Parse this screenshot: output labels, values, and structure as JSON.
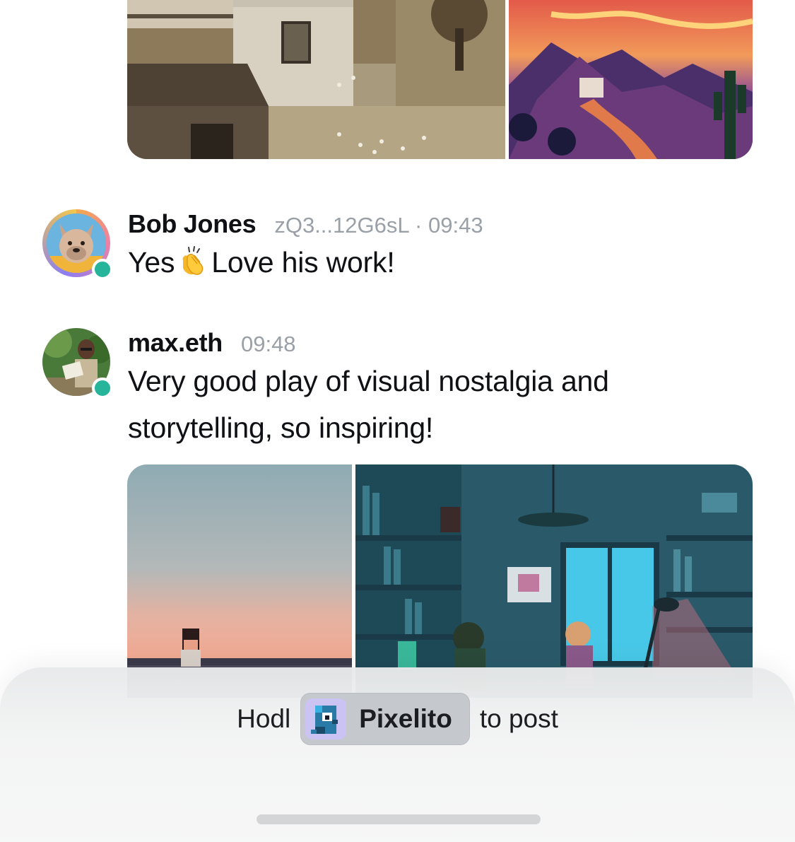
{
  "feed": {
    "top_images": [
      {
        "alt": "sepia pixel art house"
      },
      {
        "alt": "desert sunset pixel art"
      }
    ],
    "messages": [
      {
        "author": "Bob Jones",
        "meta": "zQ3...12G6sL · 09:43",
        "text_before_emoji": "Yes",
        "emoji": "clapping-hands-icon",
        "text_after_emoji": "Love his work!",
        "online": true
      },
      {
        "author": "max.eth",
        "meta": "09:48",
        "text_line1": "Very good play of visual nostalgia and",
        "text_line2": "storytelling, so inspiring!",
        "online": true
      }
    ],
    "bottom_images": [
      {
        "alt": "pixel art beach sunset"
      },
      {
        "alt": "pixel art room interior"
      }
    ]
  },
  "composer": {
    "prefix": "Hodl",
    "token_name": "Pixelito",
    "token_icon": "pixelito-bird-icon",
    "suffix": "to post"
  },
  "colors": {
    "online_status": "#26b59a",
    "meta_text": "#9aa0a8",
    "chip_background": "#c5c8cc"
  }
}
